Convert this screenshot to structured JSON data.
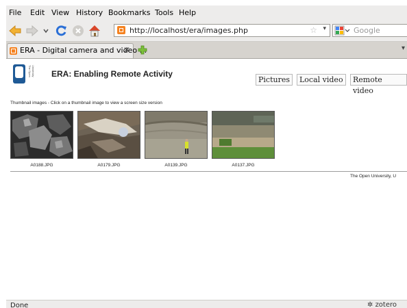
{
  "menu": {
    "items": [
      "File",
      "Edit",
      "View",
      "History",
      "Bookmarks",
      "Tools",
      "Help"
    ]
  },
  "toolbar": {
    "url": "http://localhost/era/images.php",
    "search_placeholder": "Google"
  },
  "tab": {
    "label": "ERA - Digital camera and video ..."
  },
  "page": {
    "logo_text": "The Open University",
    "title": "ERA: Enabling Remote Activity",
    "nav": [
      "Pictures",
      "Local video",
      "Remote video"
    ],
    "caption": "Thumbnail images - Click on a thumbnail image to view a screen size version",
    "thumbnails": [
      {
        "label": "A0188.JPG"
      },
      {
        "label": "A0179.JPG"
      },
      {
        "label": "A0139.JPG"
      },
      {
        "label": "A0137.JPG"
      }
    ],
    "footer": "The Open University, U"
  },
  "status": {
    "text": "Done",
    "addon": "zotero"
  },
  "colors": {
    "chrome": "#edeceb",
    "favicon": "#f58220",
    "reload": "#2a6fd6",
    "back_arrow": "#f2b233"
  }
}
